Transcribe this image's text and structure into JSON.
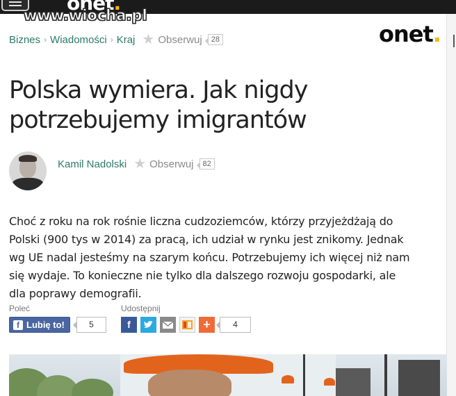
{
  "watermark": "www.wiocha.pl",
  "top_logo": {
    "text": "onet",
    "dot": "."
  },
  "breadcrumb": {
    "items": [
      "Biznes",
      "Wiadomości",
      "Kraj"
    ],
    "separator": "›",
    "follow_label": "Obserwuj",
    "follow_count": "28"
  },
  "logo": {
    "text": "onet",
    "dot": "."
  },
  "article": {
    "title_line1": "Polska wymiera. Jak nigdy",
    "title_line2": "potrzebujemy imigrantów",
    "author": {
      "name": "Kamil Nadolski",
      "follow_label": "Obserwuj",
      "follow_count": "82"
    },
    "lead_lines": [
      "Choć z roku na rok rośnie liczna cudzoziemców, którzy przyjeżdżają do",
      "Polski (900 tys w 2014) za pracą, ich udział w rynku jest znikomy. Jednak",
      "wg UE nadal jesteśmy na szarym końcu. Potrzebujemy ich więcej niż nam",
      "się wydaje. To konieczne nie tylko dla dalszego rozwoju gospodarki, ale",
      "dla poprawy demografii."
    ]
  },
  "social": {
    "recommend_label": "Poleć",
    "share_label": "Udostępnij",
    "like_button": "Lubię to!",
    "like_count": "5",
    "share_count": "4",
    "icons": [
      "facebook-icon",
      "twitter-icon",
      "mail-icon",
      "wykop-icon",
      "more-plus-icon"
    ]
  },
  "colors": {
    "link_green": "#2b7a68",
    "facebook_blue": "#3b5998",
    "twitter_blue": "#2ba9e1",
    "plus_orange": "#f06b37",
    "onet_dot": "#f5b800"
  }
}
